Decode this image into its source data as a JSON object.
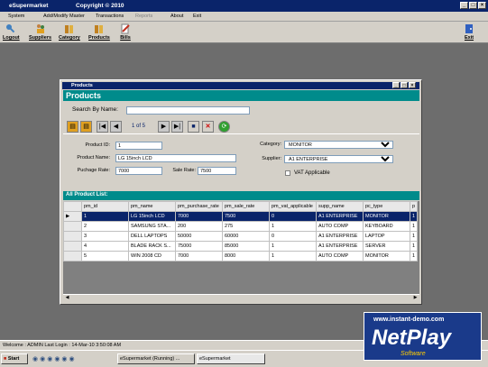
{
  "app": {
    "title": "eSupermarket",
    "copyright": "Copyright © 2010"
  },
  "menu": [
    "System",
    "Add/Modify Master",
    "Transactions",
    "Reports",
    "About",
    "Exit"
  ],
  "toolbar": {
    "logout": "Logout",
    "suppliers": "Suppliers",
    "category": "Category",
    "products": "Products",
    "bills": "Bills",
    "exit": "Exit"
  },
  "child": {
    "title": "Products",
    "header": "Products",
    "search_label": "Search By Name:",
    "search_value": "",
    "record_counter": "1 of 5",
    "product_id_label": "Product ID:",
    "product_id": "1",
    "product_name_label": "Product Name:",
    "product_name": "LG 15inch LCD",
    "purchase_rate_label": "Puchage Rate:",
    "purchase_rate": "7000",
    "sale_rate_label": "Sale Rate:",
    "sale_rate": "7500",
    "category_label": "Category:",
    "category": "MONITOR",
    "supplier_label": "Supplier:",
    "supplier": "A1 ENTERPRISE",
    "vat_label": "VAT Applicable",
    "list_header": "All Product List:"
  },
  "table": {
    "columns": [
      "pm_id",
      "pm_name",
      "pm_purchase_rate",
      "pm_sale_rate",
      "pm_vat_applicable",
      "supp_name",
      "pc_type",
      "p"
    ],
    "rows": [
      [
        "1",
        "LG 15inch LCD",
        "7000",
        "7500",
        "0",
        "A1 ENTERPRISE",
        "MONITOR",
        "1"
      ],
      [
        "2",
        "SAMSUNG STA...",
        "200",
        "275",
        "1",
        "AUTO COMP",
        "KEYBOARD",
        "1"
      ],
      [
        "3",
        "DELL LAPTOPS",
        "50000",
        "60000",
        "0",
        "A1 ENTERPRISE",
        "LAPTOP",
        "1"
      ],
      [
        "4",
        "BLADE RACK S...",
        "75000",
        "85000",
        "1",
        "A1 ENTERPRISE",
        "SERVER",
        "1"
      ],
      [
        "5",
        "WIN 2008 CD",
        "7000",
        "8000",
        "1",
        "AUTO COMP",
        "MONITOR",
        "1"
      ]
    ]
  },
  "status": "Welcome : ADMIN   Last Login : 14-Mar-10 3:50:08 AM",
  "taskbar": {
    "start": "Start",
    "task1": "eSupermarket (Running) ...",
    "task2": "eSupermarket"
  },
  "watermark": {
    "url": "www.instant-demo.com",
    "brand": "NetPlay",
    "sub": "Software"
  }
}
